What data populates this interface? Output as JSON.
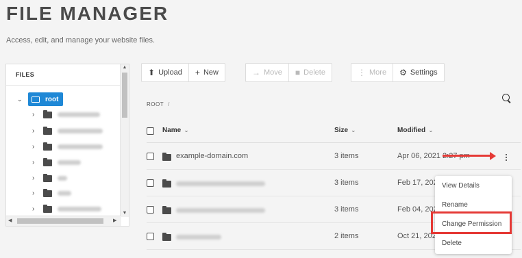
{
  "header": {
    "title": "FILE MANAGER",
    "subtitle": "Access, edit, and manage your website files."
  },
  "tree": {
    "header": "FILES",
    "root_label": "root",
    "items": [
      {
        "label": "",
        "blurred_width": 62
      },
      {
        "label": "",
        "blurred_width": 66
      },
      {
        "label": "",
        "blurred_width": 66
      },
      {
        "label": "",
        "blurred_width": 34
      },
      {
        "label": "",
        "blurred_width": 14
      },
      {
        "label": "",
        "blurred_width": 20
      },
      {
        "label": "",
        "blurred_width": 64
      }
    ]
  },
  "toolbar": {
    "upload": "Upload",
    "new": "New",
    "move": "Move",
    "delete": "Delete",
    "more": "More",
    "settings": "Settings"
  },
  "breadcrumb": {
    "root": "ROOT",
    "separator": "/"
  },
  "table": {
    "columns": {
      "name": "Name",
      "size": "Size",
      "modified": "Modified"
    },
    "rows": [
      {
        "name": "example-domain.com",
        "size": "3 items",
        "modified": "Apr 06, 2021 2:27 pm"
      },
      {
        "name": "",
        "size": "3 items",
        "modified": "Feb 17, 2021"
      },
      {
        "name": "",
        "size": "3 items",
        "modified": "Feb 04, 2021"
      },
      {
        "name": "",
        "size": "2 items",
        "modified": "Oct 21, 2020"
      }
    ]
  },
  "context_menu": {
    "items": [
      "View Details",
      "Rename",
      "Change Permission",
      "Delete"
    ],
    "highlighted": "Change Permission"
  },
  "colors": {
    "accent": "#1f88d6",
    "annotation": "#e53935"
  }
}
